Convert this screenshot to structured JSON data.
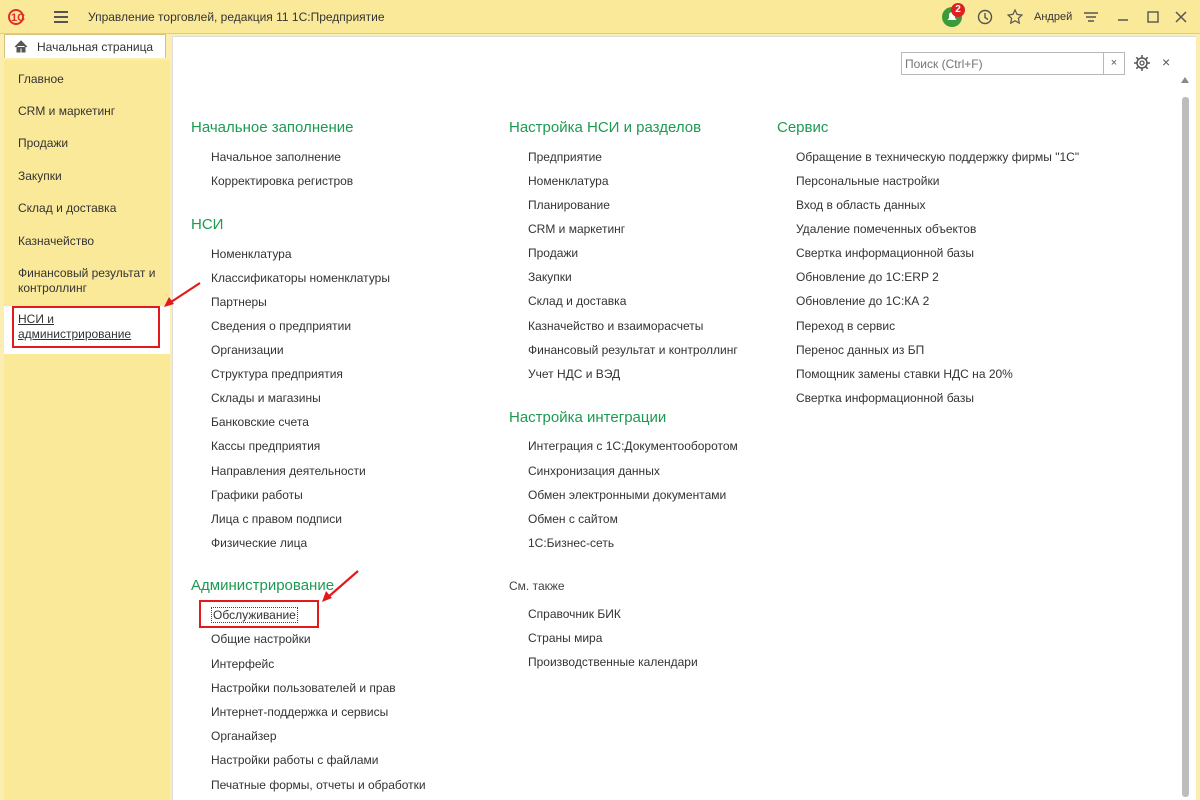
{
  "window": {
    "title": "Управление торговлей, редакция 11 1С:Предприятие",
    "logo_text": "1С",
    "notification_count": "2",
    "user": "Андрей"
  },
  "home_tab": {
    "label": "Начальная страница"
  },
  "sidebar": {
    "items": [
      {
        "label": "Главное"
      },
      {
        "label": "CRM и маркетинг"
      },
      {
        "label": "Продажи"
      },
      {
        "label": "Закупки"
      },
      {
        "label": "Склад и доставка"
      },
      {
        "label": "Казначейство"
      },
      {
        "label": "Финансовый результат и контроллинг"
      },
      {
        "label": "НСИ и администрирование"
      }
    ]
  },
  "search": {
    "placeholder": "Поиск (Ctrl+F)",
    "clear": "×"
  },
  "columns": {
    "col1": {
      "initial": {
        "title": "Начальное заполнение",
        "items": [
          "Начальное заполнение",
          "Корректировка регистров"
        ]
      },
      "nsi": {
        "title": "НСИ",
        "items": [
          "Номенклатура",
          "Классификаторы номенклатуры",
          "Партнеры",
          "Сведения о предприятии",
          "Организации",
          "Структура предприятия",
          "Склады и магазины",
          "Банковские счета",
          "Кассы предприятия",
          "Направления деятельности",
          "Графики работы",
          "Лица с правом подписи",
          "Физические лица"
        ]
      },
      "admin": {
        "title": "Администрирование",
        "items": [
          "Обслуживание",
          "Общие настройки",
          "Интерфейс",
          "Настройки пользователей и прав",
          "Интернет-поддержка и сервисы",
          "Органайзер",
          "Настройки работы с файлами",
          "Печатные формы, отчеты и обработки"
        ]
      }
    },
    "col2": {
      "nsi_setup": {
        "title": "Настройка НСИ и разделов",
        "items": [
          "Предприятие",
          "Номенклатура",
          "Планирование",
          "CRM и маркетинг",
          "Продажи",
          "Закупки",
          "Склад и доставка",
          "Казначейство и взаиморасчеты",
          "Финансовый результат и контроллинг",
          "Учет НДС и ВЭД"
        ]
      },
      "integration": {
        "title": "Настройка интеграции",
        "items": [
          "Интеграция с 1С:Документооборотом",
          "Синхронизация данных",
          "Обмен электронными документами",
          "Обмен с сайтом",
          "1С:Бизнес-сеть"
        ]
      },
      "see_also": {
        "title": "См. также",
        "items": [
          "Справочник БИК",
          "Страны мира",
          "Производственные календари"
        ]
      }
    },
    "col3": {
      "service": {
        "title": "Сервис",
        "items": [
          "Обращение в техническую поддержку фирмы \"1С\"",
          "Персональные настройки",
          "Вход в область данных",
          "Удаление помеченных объектов",
          "Свертка информационной базы",
          "Обновление до 1С:ERP 2",
          "Обновление до 1С:КА 2",
          "Переход в сервис",
          "Перенос данных из БП",
          "Помощник замены ставки НДС на 20%",
          "Свертка информационной базы"
        ]
      }
    }
  },
  "colors": {
    "accent_green": "#1d9a52",
    "sidebar_bg": "#fbe99a",
    "annotation_red": "#e11b1b"
  },
  "icons": [
    "logo-1c-icon",
    "menu-icon",
    "notifications-icon",
    "history-icon",
    "favorites-star-icon",
    "settings-lines-icon",
    "minimize-icon",
    "maximize-icon",
    "close-icon",
    "home-icon",
    "gear-icon"
  ]
}
